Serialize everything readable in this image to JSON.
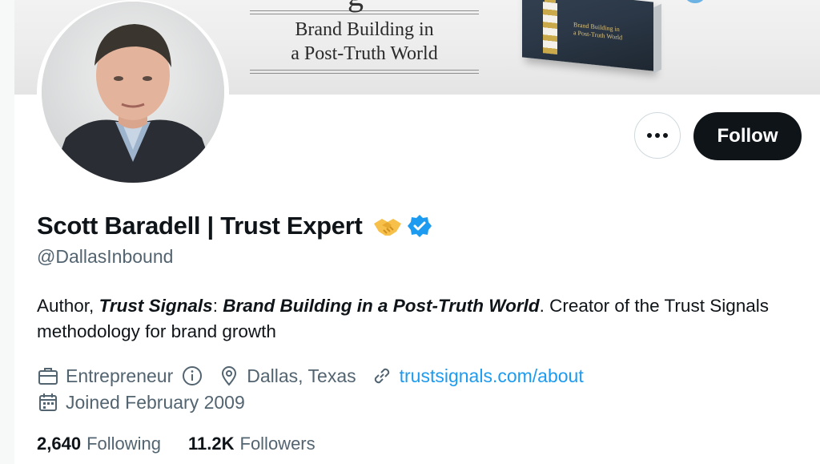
{
  "banner": {
    "glyph": "g",
    "title": "Brand Building in\na Post-Truth World",
    "book_text": "Brand Building in\na Post-Truth World"
  },
  "profile": {
    "display_name": "Scott Baradell | Trust Expert",
    "handle": "@DallasInbound",
    "bio": {
      "prefix": "Author, ",
      "italic1": "Trust Signals",
      "sep": ": ",
      "italic2": "Brand Building in a Post-Truth World",
      "suffix": ". Creator of the Trust Signals methodology for brand growth"
    },
    "category": "Entrepreneur",
    "location": "Dallas, Texas",
    "website": "trustsignals.com/about",
    "joined": "Joined February 2009"
  },
  "stats": {
    "following_count": "2,640",
    "following_label": "Following",
    "followers_count": "11.2K",
    "followers_label": "Followers"
  },
  "actions": {
    "follow_label": "Follow"
  },
  "colors": {
    "accent": "#1d9bf0",
    "text_primary": "#0f1419",
    "text_secondary": "#536471",
    "button_dark": "#0f1419"
  },
  "icons": {
    "more": "more-dots-icon",
    "verified": "verified-badge-icon",
    "handshake": "handshake-emoji-icon",
    "briefcase": "briefcase-icon",
    "info": "info-icon",
    "location": "location-pin-icon",
    "link": "link-icon",
    "calendar": "calendar-icon"
  }
}
